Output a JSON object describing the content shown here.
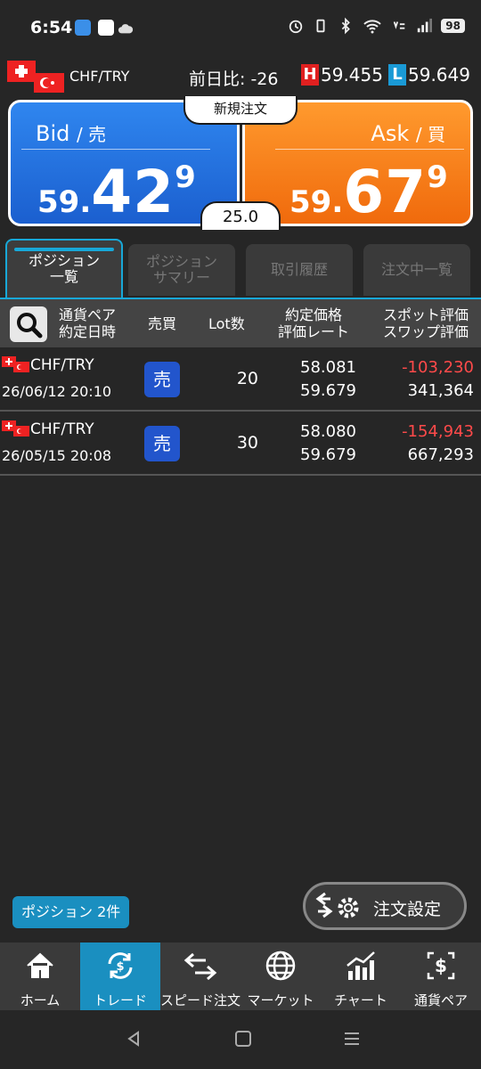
{
  "status_bar": {
    "time": "6:54",
    "battery": "98"
  },
  "pair_header": {
    "pair": "CHF/TRY",
    "prev_day_diff": "前日比: -26",
    "high_tag": "H",
    "high": "59.455",
    "low_tag": "L",
    "low": "59.649"
  },
  "quote": {
    "bid_label": "Bid",
    "bid_sub": "/ 売",
    "bid_prefix": "59.",
    "bid_main": "42",
    "bid_sup": "9",
    "ask_label": "Ask",
    "ask_sub": "/ 買",
    "ask_prefix": "59.",
    "ask_main": "67",
    "ask_sup": "9",
    "new_order": "新規注文",
    "spread": "25.0"
  },
  "tabs": [
    {
      "label": "ポジション\n一覧",
      "active": true
    },
    {
      "label": "ポジション\nサマリー",
      "active": false
    },
    {
      "label": "取引履歴",
      "active": false
    },
    {
      "label": "注文中一覧",
      "active": false
    }
  ],
  "table": {
    "headers": {
      "pair_date": "通貨ペア\n約定日時",
      "side": "売買",
      "lot": "Lot数",
      "price_rate": "約定価格\n評価レート",
      "spot_swap": "スポット評価\nスワップ評価"
    },
    "rows": [
      {
        "pair": "CHF/TRY",
        "date": "26/06/12 20:10",
        "side": "売",
        "lot": "20",
        "exec_price": "58.081",
        "eval_rate": "59.679",
        "spot": "-103,230",
        "swap": "341,364"
      },
      {
        "pair": "CHF/TRY",
        "date": "26/05/15 20:08",
        "side": "売",
        "lot": "30",
        "exec_price": "58.080",
        "eval_rate": "59.679",
        "spot": "-154,943",
        "swap": "667,293"
      }
    ]
  },
  "positions_badge": "ポジション 2件",
  "order_settings": "注文設定",
  "bottom_nav": [
    {
      "label": "ホーム",
      "icon": "home-icon",
      "active": false
    },
    {
      "label": "トレード",
      "icon": "trade-icon",
      "active": true
    },
    {
      "label": "スピード注文",
      "icon": "speed-order-icon",
      "active": false
    },
    {
      "label": "マーケット",
      "icon": "globe-icon",
      "active": false
    },
    {
      "label": "チャート",
      "icon": "chart-icon",
      "active": false
    },
    {
      "label": "通貨ペア",
      "icon": "currency-pair-icon",
      "active": false
    }
  ],
  "colors": {
    "bid_blue": "#1b5fcf",
    "ask_orange": "#f06a0c",
    "accent_cyan": "#18a8d8",
    "negative_red": "#ff4a4a",
    "high_red": "#e02020",
    "low_blue": "#1a9ad6"
  }
}
